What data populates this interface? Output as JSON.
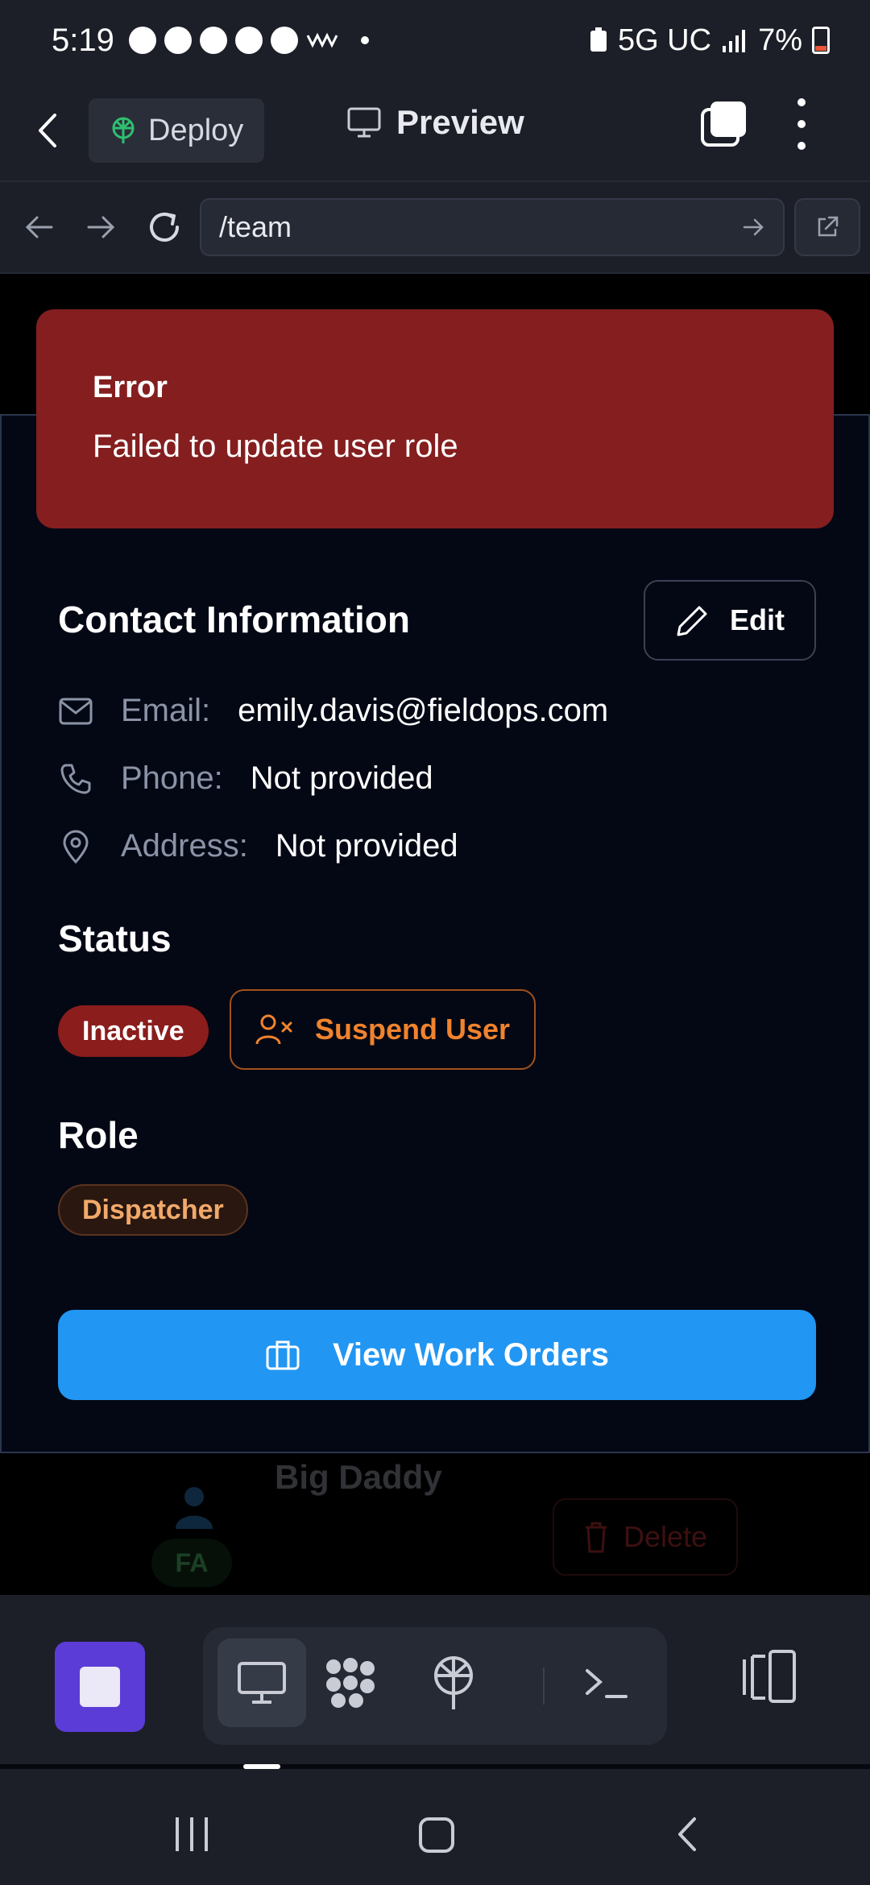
{
  "status_bar": {
    "time": "5:19",
    "network": "5G UC",
    "battery": "7%"
  },
  "app_bar": {
    "deploy_label": "Deploy",
    "preview_label": "Preview"
  },
  "browser": {
    "url": "/team"
  },
  "toast": {
    "title": "Error",
    "message": "Failed to update user role"
  },
  "contact": {
    "title": "Contact Information",
    "edit_label": "Edit",
    "rows": [
      {
        "label": "Email:",
        "value": "emily.davis@fieldops.com",
        "icon": "mail-icon"
      },
      {
        "label": "Phone:",
        "value": "Not provided",
        "icon": "phone-icon"
      },
      {
        "label": "Address:",
        "value": "Not provided",
        "icon": "map-pin-icon"
      }
    ]
  },
  "status": {
    "title": "Status",
    "badge": "Inactive",
    "suspend_label": "Suspend User"
  },
  "role": {
    "title": "Role",
    "badge": "Dispatcher"
  },
  "actions": {
    "view_work_orders": "View Work Orders"
  },
  "background_list": {
    "name": "Big Daddy",
    "initials": "FA",
    "delete_label": "Delete"
  },
  "colors": {
    "toast_bg": "#841e1f",
    "primary": "#2196f3",
    "suspend": "#f0832d",
    "inactive": "#8b1d1d",
    "role": "#f2a969",
    "stop": "#5b3cd6"
  }
}
